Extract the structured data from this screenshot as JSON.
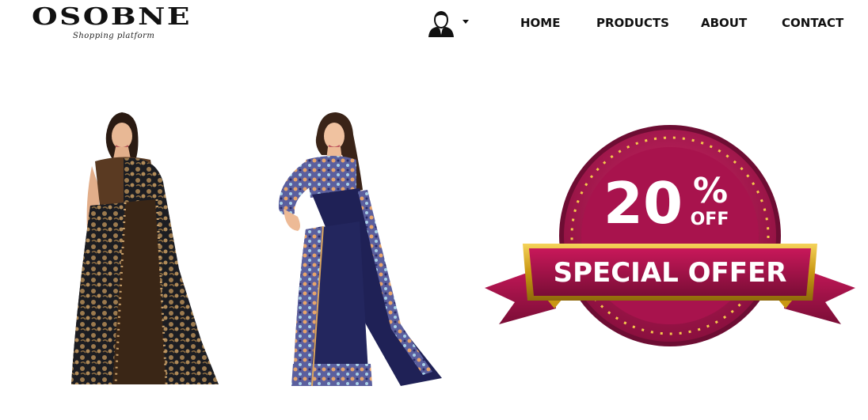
{
  "header": {
    "brand": "OSOBNE",
    "tagline": "Shopping platform",
    "user_icon": "user-avatar-icon",
    "nav": {
      "home": "HOME",
      "products": "PRODUCTS",
      "about": "ABOUT",
      "contact": "CONTACT"
    }
  },
  "main": {
    "products": [
      {
        "image": "black-floral-saree"
      },
      {
        "image": "navy-blue-saree"
      }
    ],
    "offer": {
      "percent": "20",
      "percent_sign": "%",
      "off": "OFF",
      "label": "SPECIAL OFFER"
    }
  },
  "colors": {
    "offer_primary": "#c2185b",
    "offer_gold": "#d4a514",
    "text": "#111111"
  }
}
